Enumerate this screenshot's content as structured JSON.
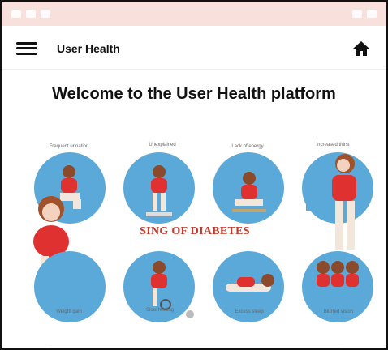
{
  "app": {
    "title": "User Health",
    "welcome_heading": "Welcome to the User Health platform"
  },
  "icons": {
    "menu": "hamburger-menu-icon",
    "home": "home-icon"
  },
  "banner": {
    "center_title": "SING OF DIABETES",
    "symptoms_top": [
      "Frequent urination",
      "Unexplained",
      "Lack of energy",
      "Increased thirst"
    ],
    "symptoms_bottom": [
      "Weight gain",
      "Slow healing",
      "Excess sleep",
      "Blurred vision"
    ]
  },
  "colors": {
    "accent": "#5aa9d8",
    "title_red": "#c0392b",
    "status_bar": "#f7dcd7"
  }
}
